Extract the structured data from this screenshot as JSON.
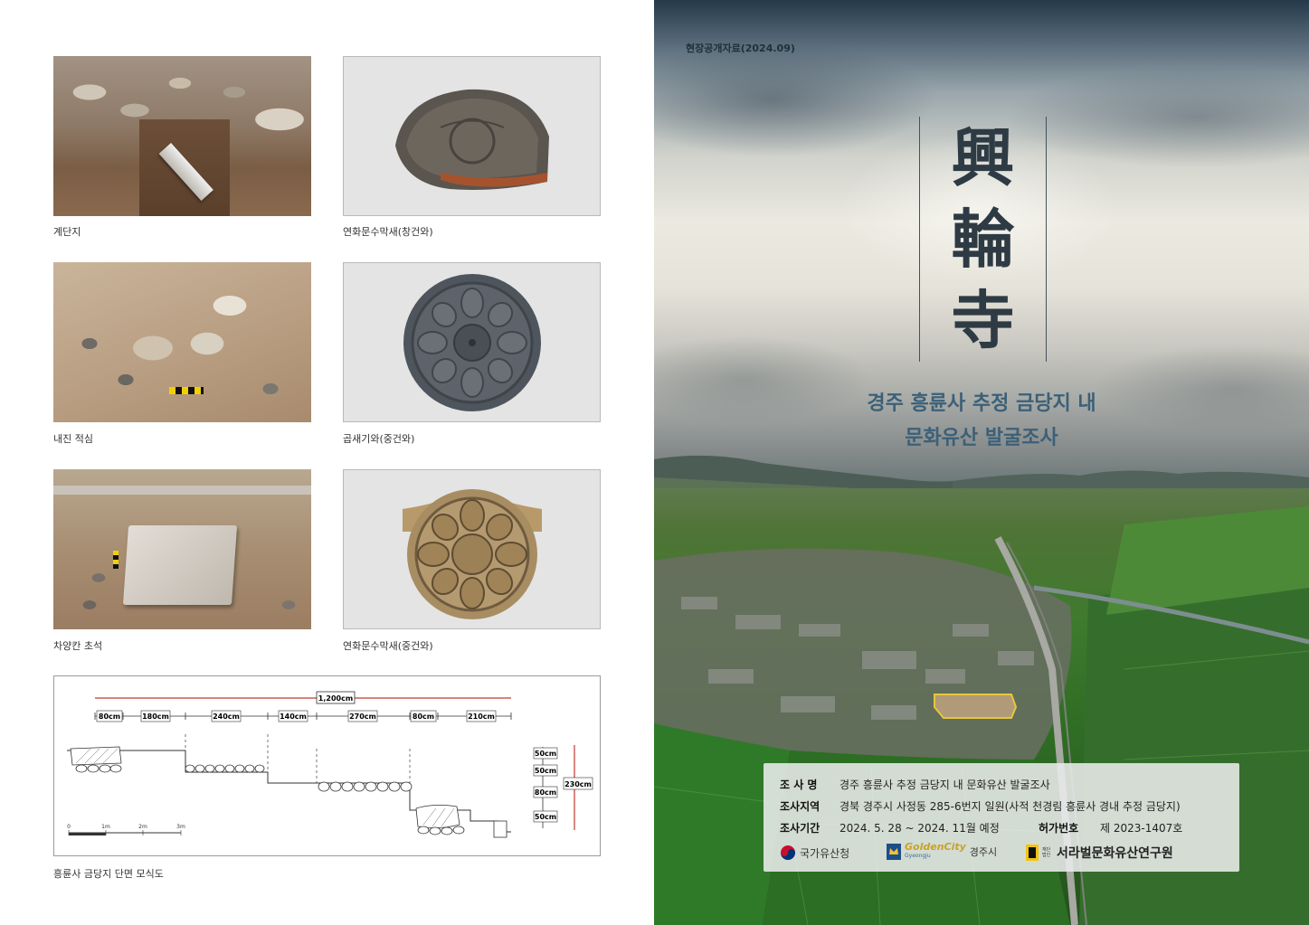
{
  "left_page": {
    "photos": [
      {
        "caption": "계단지"
      },
      {
        "caption": "연화문수막새(창건와)"
      },
      {
        "caption": "내진 적심"
      },
      {
        "caption": "곱새기와(중건와)"
      },
      {
        "caption": "차양칸 초석"
      },
      {
        "caption": "연화문수막새(중건와)"
      }
    ],
    "section_diagram": {
      "caption": "흥륜사 금당지 단면 모식도",
      "total_width": "1,200cm",
      "segments": [
        "80cm",
        "180cm",
        "240cm",
        "140cm",
        "270cm",
        "80cm",
        "210cm"
      ],
      "heights": [
        "50cm",
        "50cm",
        "80cm",
        "50cm"
      ],
      "total_height": "230cm",
      "scale_labels": [
        "0",
        "1m",
        "2m",
        "3m"
      ]
    }
  },
  "right_page": {
    "press_label": "현장공개자료(2024.09)",
    "title_chars": [
      "興",
      "輪",
      "寺"
    ],
    "subtitle_lines": [
      "경주 흥륜사 추정 금당지 내",
      "문화유산 발굴조사"
    ],
    "info": {
      "name_label": "조 사 명",
      "name_value": "경주 흥륜사 추정 금당지 내 문화유산 발굴조사",
      "area_label": "조사지역",
      "area_value": "경북 경주시 사정동 285-6번지 일원(사적 천경림 흥륜사 경내 추정 금당지)",
      "period_label": "조사기간",
      "period_value": "2024. 5. 28 ~ 2024. 11월 예정",
      "permit_label": "허가번호",
      "permit_value": "제 2023-1407호"
    },
    "logos": {
      "agency": "국가유산청",
      "city_brand": "GoldenCity",
      "city_brand_sub": "Gyeongju",
      "city": "경주시",
      "institute_prefix": "재단법인",
      "institute": "서라벌문화유산연구원"
    }
  }
}
